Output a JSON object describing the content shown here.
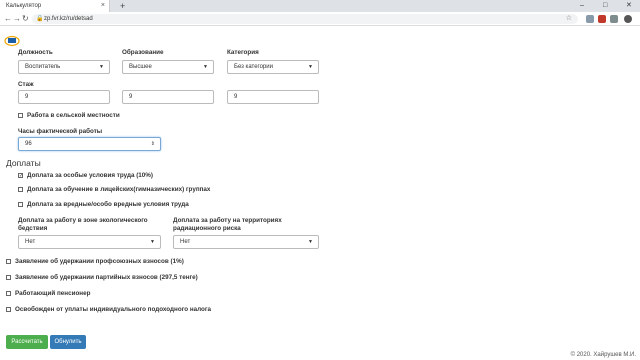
{
  "browser": {
    "tab_title": "Калькулятор",
    "tab_close": "×",
    "new_tab": "+",
    "url": "zp.fvr.kz/ru/detsad",
    "minimize": "–",
    "maximize": "□",
    "close": "✕"
  },
  "form": {
    "position_label": "Должность",
    "position_value": "Воспитатель",
    "education_label": "Образование",
    "education_value": "Высшее",
    "category_label": "Категория",
    "category_value": "Без категории",
    "experience_label": "Стаж",
    "exp1": "9",
    "exp2": "9",
    "exp3": "9",
    "rural_label": "Работа в сельской местности",
    "hours_label": "Часы фактической работы",
    "hours_value": "96",
    "allowances_heading": "Доплаты",
    "allow1": "Доплата за особые условия труда (10%)",
    "allow2": "Доплата за обучение в лицейских(гимназических) группах",
    "allow3": "Доплата за вредные/особо вредные условия труда",
    "eco_label_1": "Доплата за работу в зоне экологического",
    "eco_label_2": "бедствия",
    "eco_value": "Нет",
    "rad_label_1": "Доплата за работу на территориях",
    "rad_label_2": "радиационного риска",
    "rad_value": "Нет",
    "union_label": "Заявление об удержании профсоюзных взносов (1%)",
    "party_label": "Заявление об удержании партийных взносов (297,5 тенге)",
    "pensioner_label": "Работающий пенсионер",
    "tax_exempt_label": "Освобожден от уплаты индивидуального подоходного налога",
    "calc_button": "Рассчитать",
    "reset_button": "Обнулить",
    "footer": "© 2020. Хайрушев М.И."
  },
  "state": {
    "allow1_checked": true,
    "check_mark": "✓"
  },
  "colors": {
    "calc_button": "#4cae4c",
    "reset_button": "#337ab7"
  }
}
